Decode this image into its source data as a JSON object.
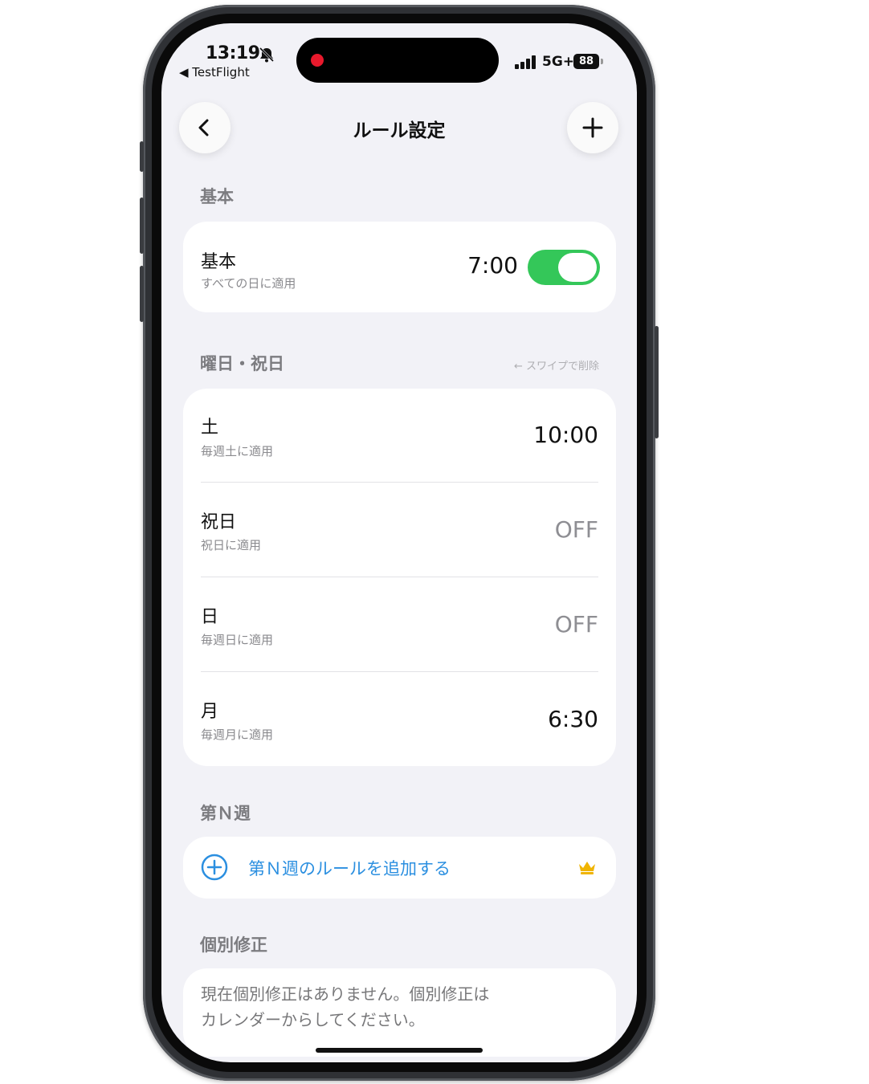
{
  "status_bar": {
    "time": "13:19",
    "back_app": "◀ TestFlight",
    "network": "5G+",
    "battery": "88"
  },
  "nav": {
    "title": "ルール設定",
    "back_icon": "chevron-left-icon",
    "add_icon": "plus-icon"
  },
  "basic": {
    "section_title": "基本",
    "row": {
      "title": "基本",
      "subtitle": "すべての日に適用",
      "time": "7:00",
      "enabled": true
    }
  },
  "weekday": {
    "section_title": "曜日・祝日",
    "hint": "← スワイプで削除",
    "rows": [
      {
        "title": "土",
        "subtitle": "毎週土に適用",
        "value": "10:00"
      },
      {
        "title": "祝日",
        "subtitle": "祝日に適用",
        "value": "OFF"
      },
      {
        "title": "日",
        "subtitle": "毎週日に適用",
        "value": "OFF"
      },
      {
        "title": "月",
        "subtitle": "毎週月に適用",
        "value": "6:30"
      }
    ]
  },
  "nth_week": {
    "section_title": "第Ｎ週",
    "add_label": "第Ｎ週のルールを追加する",
    "premium_icon": "crown-icon"
  },
  "individual": {
    "section_title": "個別修正",
    "note_line1": "現在個別修正はありません。個別修正は",
    "note_line2": "カレンダーからしてください。"
  },
  "colors": {
    "accent_blue": "#2b8fe0",
    "toggle_green": "#34c759",
    "crown_gold": "#f0b400",
    "background": "#f2f2f7"
  }
}
